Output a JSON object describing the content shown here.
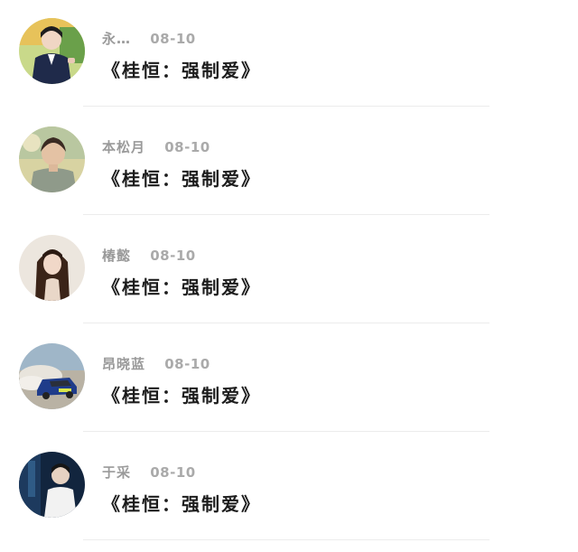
{
  "comments": [
    {
      "name": "永…",
      "date": "08-10",
      "text": "《桂恒：强制爱》",
      "avatar_icon": "avatar-boy-school-uniform"
    },
    {
      "name": "本松月",
      "date": "08-10",
      "text": "《桂恒：强制爱》",
      "avatar_icon": "avatar-boy-portrait"
    },
    {
      "name": "椿懿",
      "date": "08-10",
      "text": "《桂恒：强制爱》",
      "avatar_icon": "avatar-girl-long-hair"
    },
    {
      "name": "昂晓蓝",
      "date": "08-10",
      "text": "《桂恒：强制爱》",
      "avatar_icon": "avatar-rally-car"
    },
    {
      "name": "于采",
      "date": "08-10",
      "text": "《桂恒：强制爱》",
      "avatar_icon": "avatar-night-person"
    }
  ]
}
